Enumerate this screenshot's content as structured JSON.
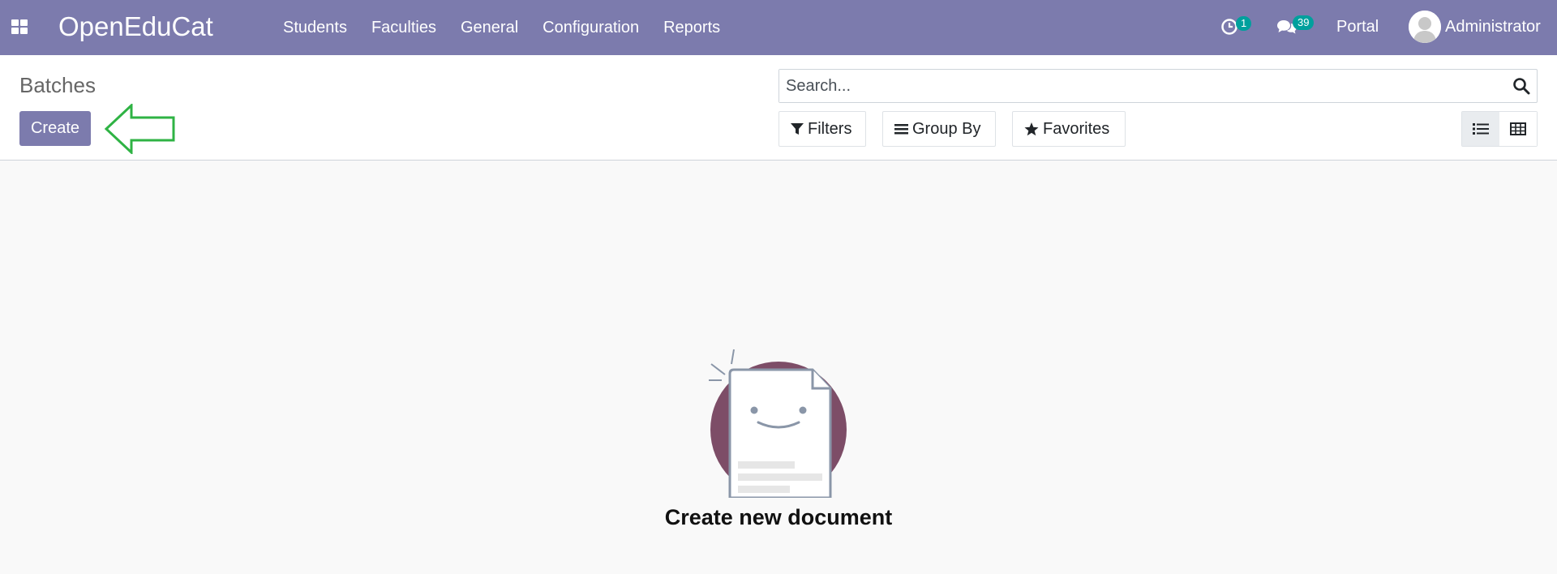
{
  "navbar": {
    "apps_icon": "apps-grid-icon",
    "brand": "OpenEduCat",
    "menu": [
      {
        "label": "Students"
      },
      {
        "label": "Faculties"
      },
      {
        "label": "General"
      },
      {
        "label": "Configuration"
      },
      {
        "label": "Reports"
      }
    ],
    "activity_badge": "1",
    "messages_badge": "39",
    "portal": "Portal",
    "user_name": "Administrator"
  },
  "control_panel": {
    "title": "Batches",
    "create_label": "Create",
    "search_placeholder": "Search...",
    "filters_label": "Filters",
    "group_by_label": "Group By",
    "favorites_label": "Favorites",
    "views": [
      "list-view-icon",
      "grid-view-icon"
    ],
    "active_view": "list"
  },
  "empty_state": {
    "title": "Create new document"
  },
  "colors": {
    "navbar": "#7c7bad",
    "primary": "#7c7bad",
    "badge": "#00a09d",
    "annotation_arrow": "#2fb344",
    "illustration_circle": "#7d4d67"
  }
}
